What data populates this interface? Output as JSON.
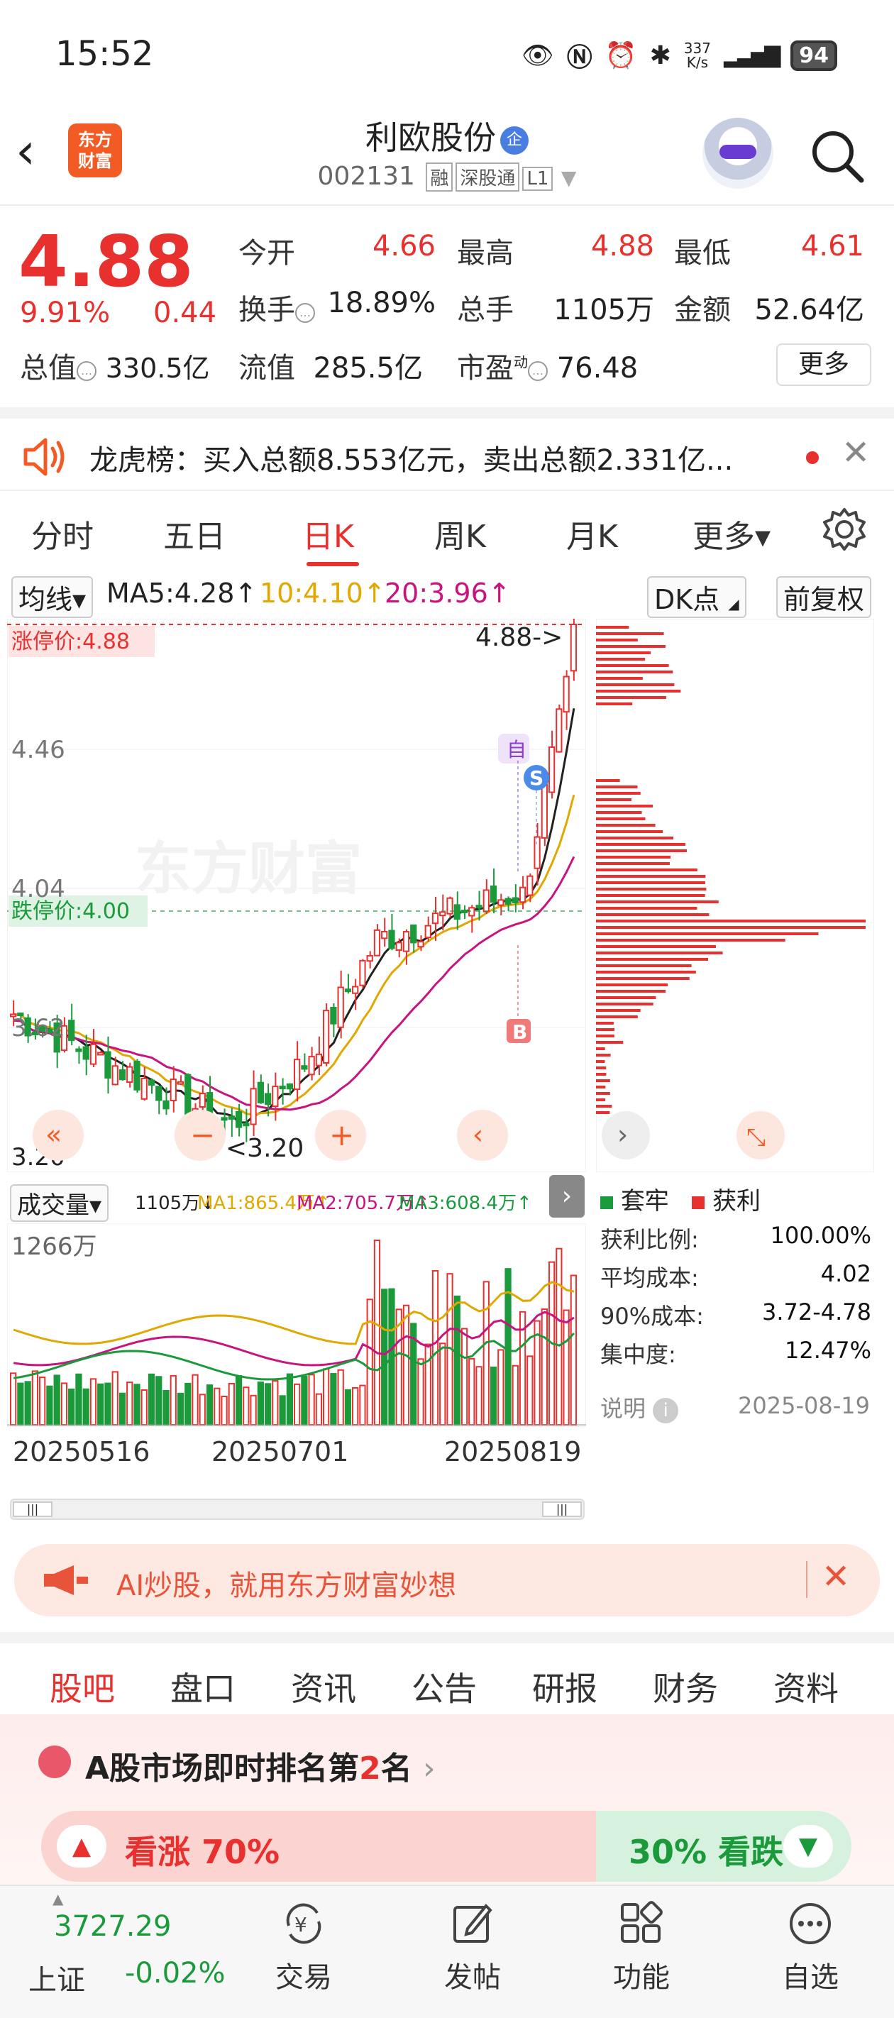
{
  "status": {
    "time": "15:52",
    "net_speed": "337\nK/s",
    "battery": "94"
  },
  "header": {
    "back": "‹",
    "logo": "东方\n财富",
    "name": "利欧股份",
    "name_badge": "企",
    "code": "002131",
    "tags": [
      "融",
      "深股通",
      "L1"
    ]
  },
  "quote": {
    "price": "4.88",
    "change_pct": "9.91%",
    "change": "0.44",
    "rows": [
      [
        {
          "label": "今开",
          "value": "4.66",
          "color": "red"
        },
        {
          "label": "最高",
          "value": "4.88",
          "color": "red"
        },
        {
          "label": "最低",
          "value": "4.61",
          "color": "red"
        }
      ],
      [
        {
          "label": "换手",
          "value": "18.89%",
          "color": "dark"
        },
        {
          "label": "总手",
          "value": "1105万",
          "color": "dark"
        },
        {
          "label": "金额",
          "value": "52.64亿",
          "color": "dark"
        }
      ]
    ],
    "mkt_cap_label": "总值",
    "mkt_cap": "330.5亿",
    "float_label": "流值",
    "float_cap": "285.5亿",
    "pe_label": "市盈",
    "pe_sup": "动",
    "pe": "76.48",
    "more": "更多"
  },
  "dragon_tiger": {
    "text": "龙虎榜：买入总额8.553亿元，卖出总额2.331亿..."
  },
  "ktabs": [
    "分时",
    "五日",
    "日K",
    "周K",
    "月K",
    "更多▾"
  ],
  "ma": {
    "selector": "均线▾",
    "ma5": "MA5:4.28↑",
    "ma10": "10:4.10↑",
    "ma20": "20:3.96↑",
    "dk": "DK点",
    "adjust": "前复权"
  },
  "chart": {
    "limit_up": "涨停价:4.88",
    "limit_down": "跌停价:4.00",
    "y_labels": [
      "4.46",
      "4.04",
      "3.62",
      "3.20"
    ],
    "last_price": "4.88->",
    "low_marker": "<3.20",
    "marker_self": "自",
    "marker_s": "S",
    "marker_b": "B",
    "watermark": "东方财富"
  },
  "volume": {
    "selector": "成交量▾",
    "vol": "1105万↓",
    "ma1": "MA1:865.4万↑",
    "ma2": "MA2:705.7万↑",
    "ma3": "MA3:608.4万↑",
    "max_label": "1266万",
    "dates": [
      "20250516",
      "20250701",
      "20250819"
    ]
  },
  "chip": {
    "legend_trap": "套牢",
    "legend_profit": "获利",
    "stats": [
      {
        "label": "获利比例:",
        "value": "100.00%"
      },
      {
        "label": "平均成本:",
        "value": "4.02"
      },
      {
        "label": "90%成本:",
        "value": "3.72-4.78"
      },
      {
        "label": "集中度:",
        "value": "12.47%"
      }
    ],
    "note": "说明",
    "date": "2025-08-19"
  },
  "ai_banner": "AI炒股，就用东方财富妙想",
  "bottom_tabs": [
    "股吧",
    "盘口",
    "资讯",
    "公告",
    "研报",
    "财务",
    "资料"
  ],
  "rank": {
    "title_pre": "A股市场即时排名第",
    "rank_no": "2",
    "title_post": "名",
    "bull": "看涨 70%",
    "bear": "30% 看跌"
  },
  "bottombar": {
    "index_value": "3727.29",
    "index_name": "上证",
    "index_change": "-0.02%",
    "items": [
      "交易",
      "发帖",
      "功能",
      "自选"
    ]
  },
  "colors": {
    "accent": "#e8312f",
    "green": "#1a9a3a",
    "orange": "#f25c24"
  }
}
